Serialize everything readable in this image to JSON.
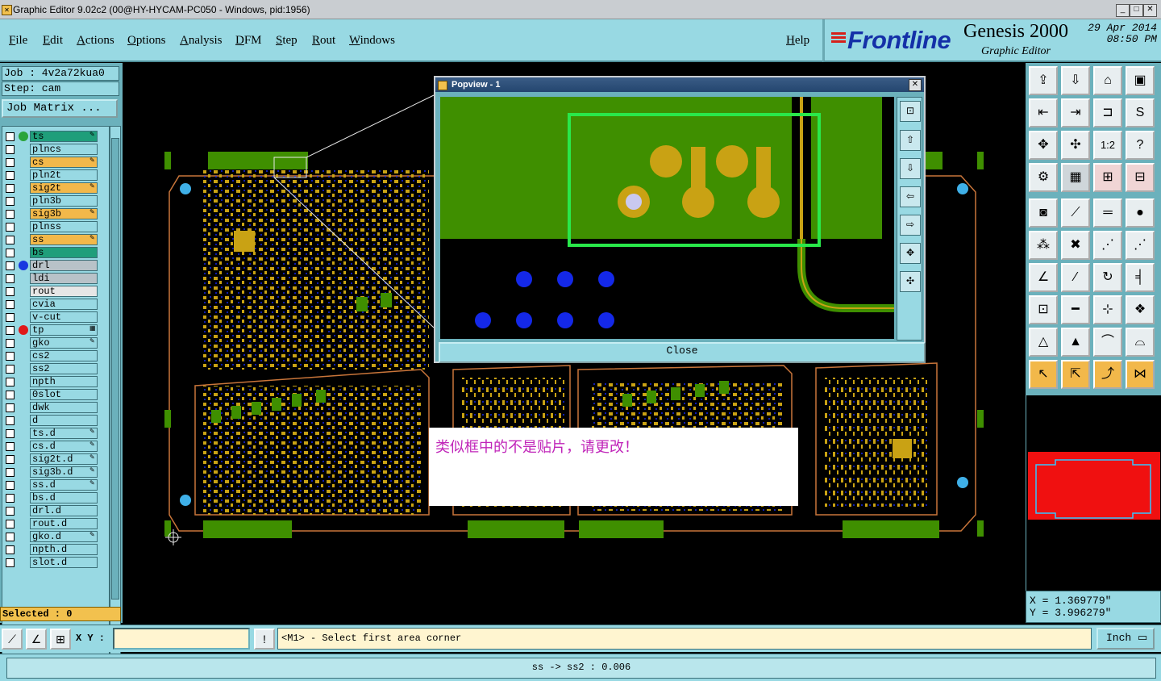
{
  "window": {
    "title": "Graphic Editor 9.02c2 (00@HY-HYCAM-PC050 - Windows, pid:1956)"
  },
  "menubar": {
    "items": [
      "File",
      "Edit",
      "Actions",
      "Options",
      "Analysis",
      "DFM",
      "Step",
      "Rout",
      "Windows"
    ],
    "help": "Help"
  },
  "brand": {
    "logo": "Frontline",
    "product": "Genesis 2000",
    "subtitle": "Graphic Editor",
    "date": "29 Apr 2014",
    "time": "08:50 PM"
  },
  "job": {
    "job_line": "Job : 4v2a72kua0",
    "step_line": "Step: cam",
    "matrix_button": "Job Matrix ..."
  },
  "layers": [
    {
      "name": "ts",
      "color": "#1f9e7a",
      "dot": "#2aa43a",
      "flag": "✎"
    },
    {
      "name": "plncs",
      "color": "#98d9e3"
    },
    {
      "name": "cs",
      "color": "#f2b84a",
      "flag": "✎"
    },
    {
      "name": "pln2t",
      "color": "#98d9e3"
    },
    {
      "name": "sig2t",
      "color": "#f2b84a",
      "flag": "✎"
    },
    {
      "name": "pln3b",
      "color": "#98d9e3"
    },
    {
      "name": "sig3b",
      "color": "#f2b84a",
      "flag": "✎"
    },
    {
      "name": "plnss",
      "color": "#98d9e3"
    },
    {
      "name": "ss",
      "color": "#f2b84a",
      "flag": "✎"
    },
    {
      "name": "bs",
      "color": "#1f9e7a"
    },
    {
      "name": "drl",
      "color": "#b8c2c8",
      "dot": "#1838e0"
    },
    {
      "name": "ldi",
      "color": "#b8c2c8"
    },
    {
      "name": "rout",
      "color": "#e6e6e6"
    },
    {
      "name": "cvia",
      "color": "#98d9e3"
    },
    {
      "name": "v-cut",
      "color": "#98d9e3"
    },
    {
      "name": "tp",
      "color": "#98d9e3",
      "dot": "#e01818",
      "flag": "▦"
    },
    {
      "name": "gko",
      "color": "#98d9e3",
      "flag": "✎"
    },
    {
      "name": "cs2",
      "color": "#98d9e3"
    },
    {
      "name": "ss2",
      "color": "#98d9e3"
    },
    {
      "name": "npth",
      "color": "#98d9e3"
    },
    {
      "name": "0slot",
      "color": "#98d9e3"
    },
    {
      "name": "dwk",
      "color": "#98d9e3"
    },
    {
      "name": "d",
      "color": "#98d9e3"
    },
    {
      "name": "ts.d",
      "color": "#98d9e3",
      "flag": "✎"
    },
    {
      "name": "cs.d",
      "color": "#98d9e3",
      "flag": "✎"
    },
    {
      "name": "sig2t.d",
      "color": "#98d9e3",
      "flag": "✎"
    },
    {
      "name": "sig3b.d",
      "color": "#98d9e3",
      "flag": "✎"
    },
    {
      "name": "ss.d",
      "color": "#98d9e3",
      "flag": "✎"
    },
    {
      "name": "bs.d",
      "color": "#98d9e3"
    },
    {
      "name": "drl.d",
      "color": "#98d9e3"
    },
    {
      "name": "rout.d",
      "color": "#98d9e3"
    },
    {
      "name": "gko.d",
      "color": "#98d9e3",
      "flag": "✎"
    },
    {
      "name": "npth.d",
      "color": "#98d9e3"
    },
    {
      "name": "slot.d",
      "color": "#98d9e3"
    }
  ],
  "selected": "Selected : 0",
  "popview": {
    "title": "Popview - 1",
    "close_button": "Close"
  },
  "annotation": {
    "text": "类似框中的不是贴片，请更改！"
  },
  "coords": {
    "x": "X =  1.369779\"",
    "y": "Y =  3.996279\""
  },
  "command": {
    "xy_label": "X Y :",
    "xy_value": "",
    "prompt": "<M1> - Select first area corner",
    "units": "Inch"
  },
  "status": "ss -> ss2 : 0.006",
  "colors": {
    "panel": "#98d9e3",
    "board": "#3f8f00",
    "copper": "#c9a214",
    "drill": "#1428e8",
    "outline": "#c9753a"
  }
}
